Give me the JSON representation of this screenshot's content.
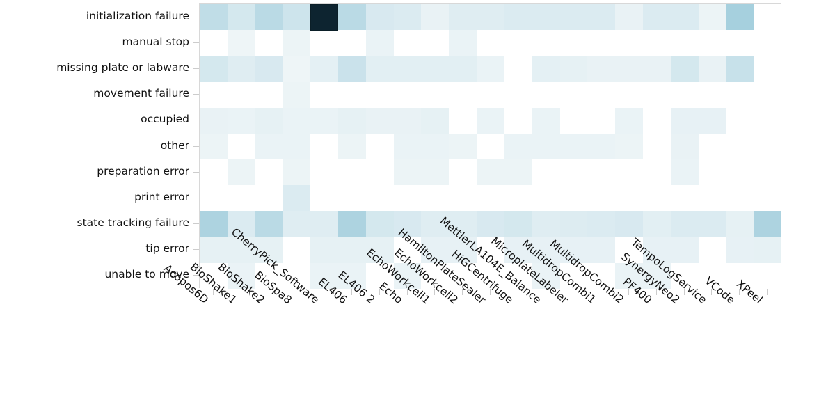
{
  "chart_data": {
    "type": "heatmap",
    "title": "",
    "xlabel": "",
    "ylabel": "",
    "grid": false,
    "legend": "none",
    "colormap": {
      "name": "blue-sequential",
      "low_color": "#ffffff",
      "mid_color": "#a8d0de",
      "high_color": "#0d2430",
      "vmin": 0,
      "vmax": 1
    },
    "x_categories": [
      "Acopos6D",
      "BioShake1",
      "BioShake2",
      "BioSpa8",
      "CherryPick_Software",
      "EL406",
      "EL406 2",
      "Echo",
      "EchoWorkcell1",
      "EchoWorkcell2",
      "HamiltonPlateSealer",
      "HiGCentrifuge",
      "MettlerLA104E_Balance",
      "MicroplateLabeler",
      "MultidropCombi1",
      "MultidropCombi2",
      "PF400",
      "SynergyNeo2",
      "TempoLogService",
      "VCode",
      "XPeel"
    ],
    "y_categories": [
      "initialization failure",
      "manual stop",
      "missing plate or labware",
      "movement failure",
      "occupied",
      "other",
      "preparation error",
      "print error",
      "state tracking failure",
      "tip error",
      "unable to move"
    ],
    "highlighted_cell": {
      "row": "initialization failure",
      "column": "CherryPick_Software",
      "value": 1.0
    },
    "values": [
      [
        0.3,
        0.22,
        0.32,
        0.26,
        1.0,
        0.32,
        0.2,
        0.18,
        0.1,
        0.16,
        0.16,
        0.18,
        0.18,
        0.18,
        0.18,
        0.1,
        0.18,
        0.18,
        0.08,
        0.38,
        0.0
      ],
      [
        0.0,
        0.07,
        0.0,
        0.08,
        0.0,
        0.0,
        0.09,
        0.0,
        0.0,
        0.09,
        0.0,
        0.0,
        0.0,
        0.0,
        0.0,
        0.0,
        0.0,
        0.0,
        0.0,
        0.0,
        0.0
      ],
      [
        0.22,
        0.16,
        0.2,
        0.07,
        0.13,
        0.27,
        0.14,
        0.14,
        0.14,
        0.14,
        0.09,
        0.0,
        0.13,
        0.12,
        0.1,
        0.1,
        0.1,
        0.22,
        0.1,
        0.28,
        0.0
      ],
      [
        0.0,
        0.0,
        0.0,
        0.08,
        0.0,
        0.0,
        0.0,
        0.0,
        0.0,
        0.0,
        0.0,
        0.0,
        0.0,
        0.0,
        0.0,
        0.0,
        0.0,
        0.0,
        0.0,
        0.0,
        0.0
      ],
      [
        0.1,
        0.09,
        0.12,
        0.09,
        0.09,
        0.12,
        0.1,
        0.1,
        0.12,
        0.0,
        0.09,
        0.0,
        0.09,
        0.0,
        0.0,
        0.09,
        0.0,
        0.11,
        0.11,
        0.0,
        0.0
      ],
      [
        0.08,
        0.0,
        0.09,
        0.09,
        0.0,
        0.08,
        0.0,
        0.09,
        0.09,
        0.08,
        0.0,
        0.09,
        0.09,
        0.09,
        0.09,
        0.08,
        0.0,
        0.1,
        0.0,
        0.0,
        0.0
      ],
      [
        0.0,
        0.08,
        0.0,
        0.08,
        0.0,
        0.0,
        0.0,
        0.08,
        0.08,
        0.0,
        0.08,
        0.08,
        0.0,
        0.0,
        0.0,
        0.0,
        0.0,
        0.09,
        0.0,
        0.0,
        0.0
      ],
      [
        0.0,
        0.0,
        0.0,
        0.18,
        0.0,
        0.0,
        0.0,
        0.0,
        0.0,
        0.0,
        0.0,
        0.0,
        0.0,
        0.0,
        0.0,
        0.0,
        0.0,
        0.0,
        0.0,
        0.0,
        0.0
      ],
      [
        0.36,
        0.18,
        0.32,
        0.16,
        0.16,
        0.36,
        0.22,
        0.2,
        0.16,
        0.16,
        0.2,
        0.22,
        0.16,
        0.17,
        0.18,
        0.2,
        0.14,
        0.18,
        0.18,
        0.12,
        0.36
      ],
      [
        0.12,
        0.12,
        0.12,
        0.0,
        0.12,
        0.12,
        0.12,
        0.0,
        0.11,
        0.11,
        0.0,
        0.11,
        0.11,
        0.11,
        0.11,
        0.0,
        0.11,
        0.11,
        0.0,
        0.11,
        0.12
      ],
      [
        0.0,
        0.09,
        0.0,
        0.0,
        0.09,
        0.09,
        0.0,
        0.09,
        0.0,
        0.0,
        0.0,
        0.0,
        0.09,
        0.0,
        0.0,
        0.09,
        0.09,
        0.0,
        0.0,
        0.0,
        0.0
      ]
    ]
  }
}
